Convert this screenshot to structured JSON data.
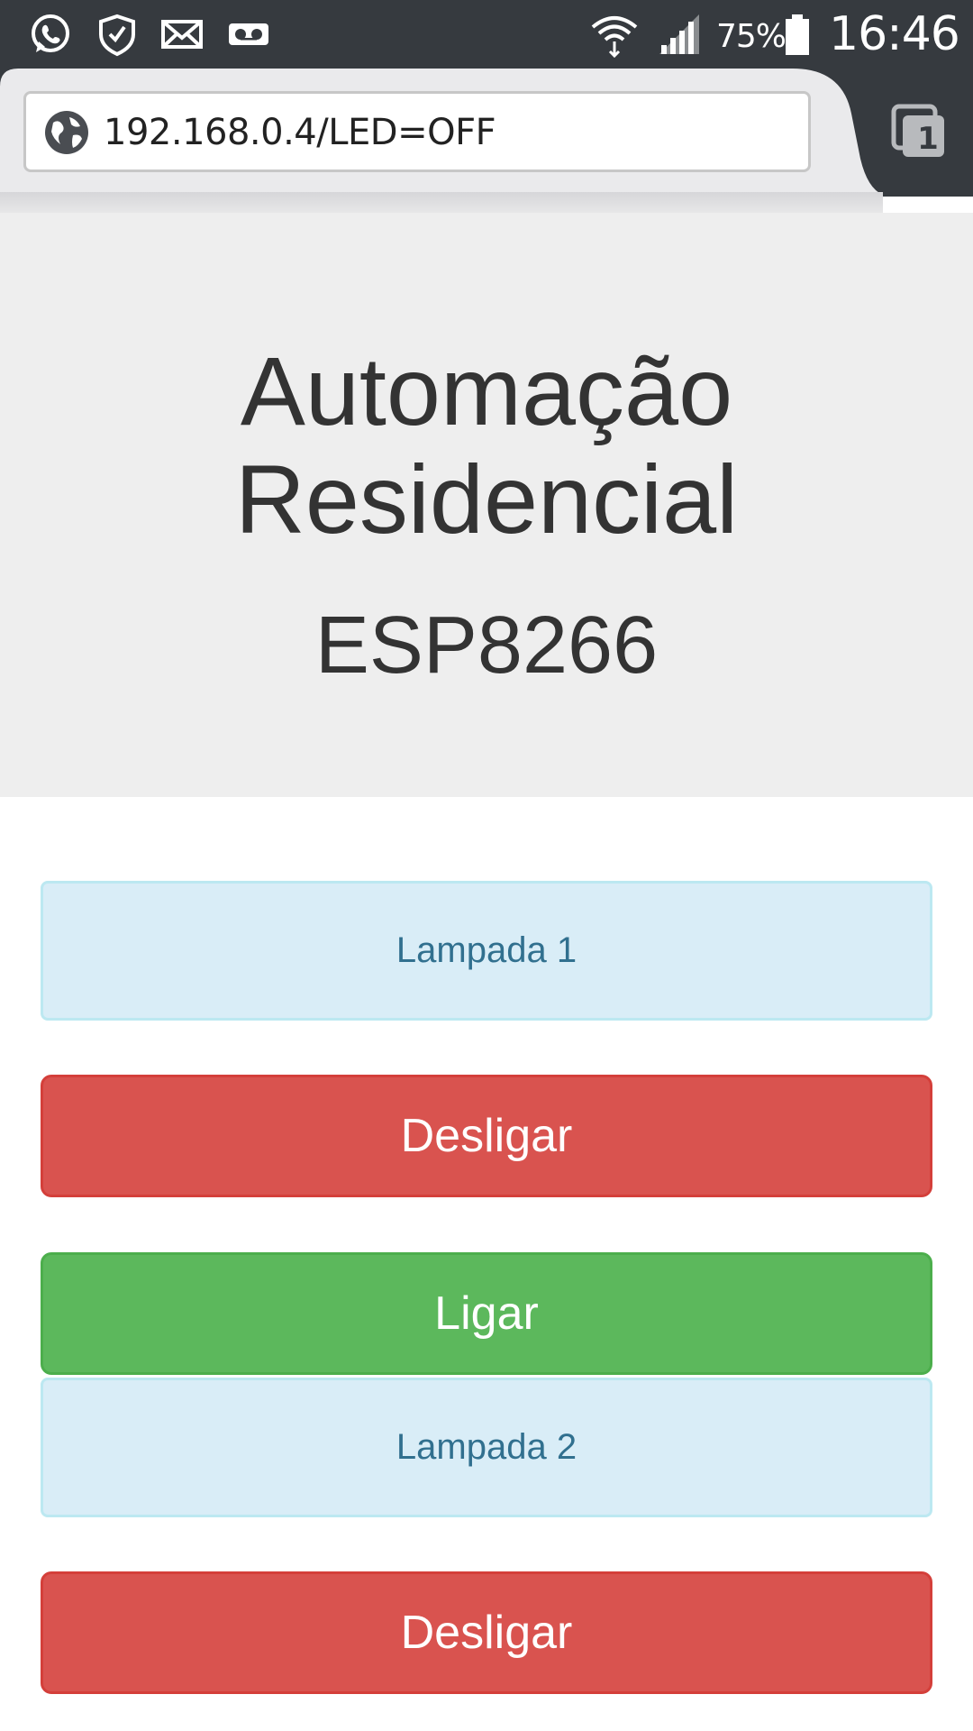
{
  "status_bar": {
    "icons": [
      "whatsapp-icon",
      "shield-icon",
      "mail-icon",
      "voicemail-icon",
      "wifi-icon",
      "signal-icon",
      "battery-icon"
    ],
    "battery_percent": "75%",
    "time": "16:46"
  },
  "browser": {
    "url": "192.168.0.4/LED=OFF",
    "tab_count": "1"
  },
  "page": {
    "title_line1": "Automação",
    "title_line2": "Residencial",
    "subtitle": "ESP8266",
    "sections": [
      {
        "label": "Lampada 1",
        "off_label": "Desligar",
        "on_label": "Ligar"
      },
      {
        "label": "Lampada 2",
        "off_label": "Desligar"
      }
    ]
  },
  "colors": {
    "status_bar": "#363a3f",
    "jumbotron": "#eeeeee",
    "panel_bg": "#d9edf7",
    "panel_text": "#31708f",
    "danger": "#d9534f",
    "success": "#5cb85c"
  }
}
